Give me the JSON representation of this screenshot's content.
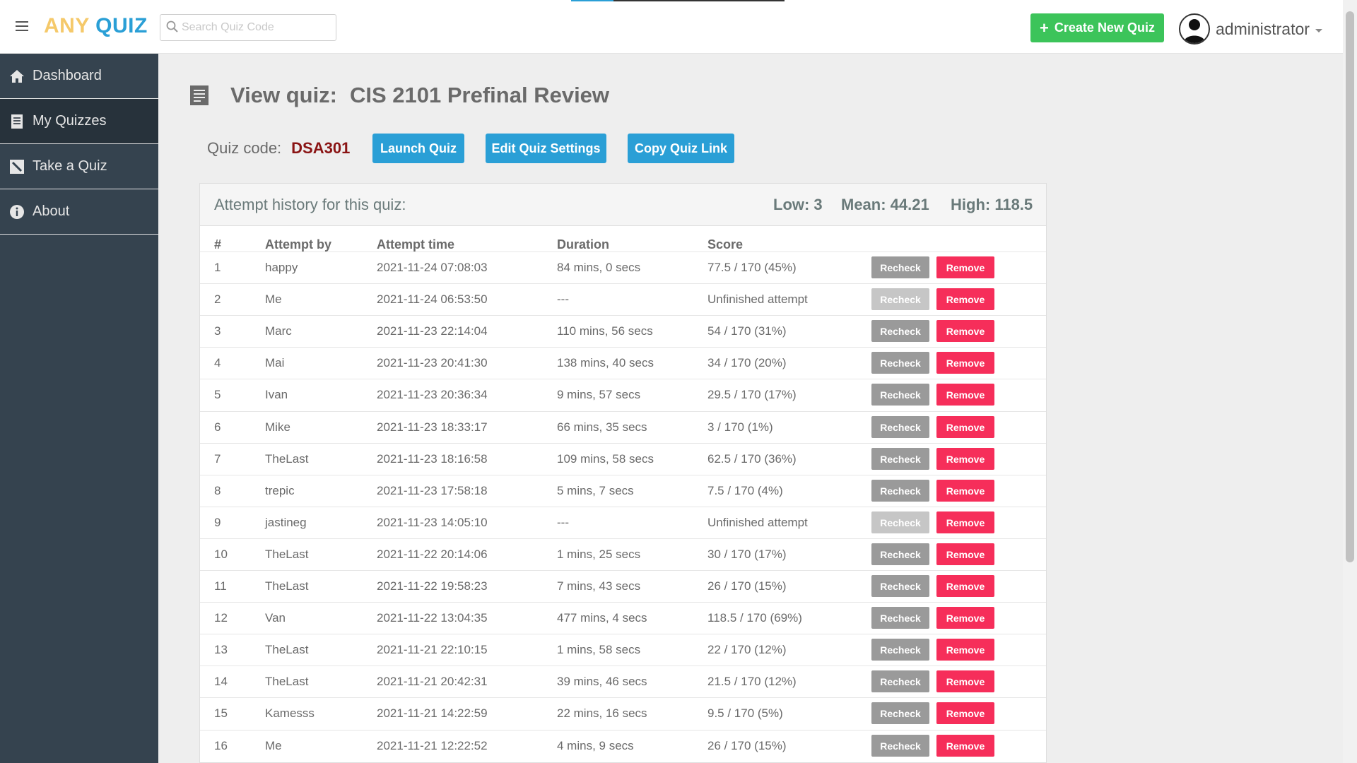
{
  "header": {
    "brand_any": "ANY",
    "brand_quiz": "QUIZ",
    "search_placeholder": "Search Quiz Code",
    "create_label": "Create New Quiz",
    "user_name": "administrator"
  },
  "sidebar": {
    "items": [
      {
        "label": "Dashboard",
        "icon": "home-icon"
      },
      {
        "label": "My Quizzes",
        "icon": "document-icon",
        "active": true
      },
      {
        "label": "Take a Quiz",
        "icon": "pencil-icon"
      },
      {
        "label": "About",
        "icon": "info-icon"
      }
    ]
  },
  "page": {
    "title_prefix": "View quiz:",
    "title_name": "CIS 2101 Prefinal Review",
    "quiz_code_label": "Quiz code:",
    "quiz_code": "DSA301",
    "launch_label": "Launch Quiz",
    "edit_label": "Edit Quiz Settings",
    "copy_label": "Copy Quiz Link"
  },
  "history": {
    "title": "Attempt history for this quiz:",
    "low": "Low: 3",
    "mean": "Mean: 44.21",
    "high": "High: 118.5",
    "columns": [
      "#",
      "Attempt by",
      "Attempt time",
      "Duration",
      "Score"
    ],
    "recheck_label": "Recheck",
    "remove_label": "Remove",
    "rows": [
      {
        "num": "1",
        "by": "happy",
        "time": "2021-11-24 07:08:03",
        "duration": "84 mins, 0 secs",
        "score": "77.5 / 170 (45%)",
        "finished": true
      },
      {
        "num": "2",
        "by": "Me",
        "time": "2021-11-24 06:53:50",
        "duration": "---",
        "score": "Unfinished attempt",
        "finished": false
      },
      {
        "num": "3",
        "by": "Marc",
        "time": "2021-11-23 22:14:04",
        "duration": "110 mins, 56 secs",
        "score": "54 / 170 (31%)",
        "finished": true
      },
      {
        "num": "4",
        "by": "Mai",
        "time": "2021-11-23 20:41:30",
        "duration": "138 mins, 40 secs",
        "score": "34 / 170 (20%)",
        "finished": true
      },
      {
        "num": "5",
        "by": "Ivan",
        "time": "2021-11-23 20:36:34",
        "duration": "9 mins, 57 secs",
        "score": "29.5 / 170 (17%)",
        "finished": true
      },
      {
        "num": "6",
        "by": "Mike",
        "time": "2021-11-23 18:33:17",
        "duration": "66 mins, 35 secs",
        "score": "3 / 170 (1%)",
        "finished": true
      },
      {
        "num": "7",
        "by": "TheLast",
        "time": "2021-11-23 18:16:58",
        "duration": "109 mins, 58 secs",
        "score": "62.5 / 170 (36%)",
        "finished": true
      },
      {
        "num": "8",
        "by": "trepic",
        "time": "2021-11-23 17:58:18",
        "duration": "5 mins, 7 secs",
        "score": "7.5 / 170 (4%)",
        "finished": true
      },
      {
        "num": "9",
        "by": "jastineg",
        "time": "2021-11-23 14:05:10",
        "duration": "---",
        "score": "Unfinished attempt",
        "finished": false
      },
      {
        "num": "10",
        "by": "TheLast",
        "time": "2021-11-22 20:14:06",
        "duration": "1 mins, 25 secs",
        "score": "30 / 170 (17%)",
        "finished": true
      },
      {
        "num": "11",
        "by": "TheLast",
        "time": "2021-11-22 19:58:23",
        "duration": "7 mins, 43 secs",
        "score": "26 / 170 (15%)",
        "finished": true
      },
      {
        "num": "12",
        "by": "Van",
        "time": "2021-11-22 13:04:35",
        "duration": "477 mins, 4 secs",
        "score": "118.5 / 170 (69%)",
        "finished": true
      },
      {
        "num": "13",
        "by": "TheLast",
        "time": "2021-11-21 22:10:15",
        "duration": "1 mins, 58 secs",
        "score": "22 / 170 (12%)",
        "finished": true
      },
      {
        "num": "14",
        "by": "TheLast",
        "time": "2021-11-21 20:42:31",
        "duration": "39 mins, 46 secs",
        "score": "21.5 / 170 (12%)",
        "finished": true
      },
      {
        "num": "15",
        "by": "Kamesss",
        "time": "2021-11-21 14:22:59",
        "duration": "22 mins, 16 secs",
        "score": "9.5 / 170 (5%)",
        "finished": true
      },
      {
        "num": "16",
        "by": "Me",
        "time": "2021-11-21 12:22:52",
        "duration": "4 mins, 9 secs",
        "score": "26 / 170 (15%)",
        "finished": true
      }
    ]
  },
  "colors": {
    "brand_any": "#f5c96a",
    "brand_quiz": "#2a9fd6",
    "primary": "#2a9fd6",
    "success": "#3cc45a",
    "danger": "#f62e5a",
    "sidebar": "#35434f"
  }
}
